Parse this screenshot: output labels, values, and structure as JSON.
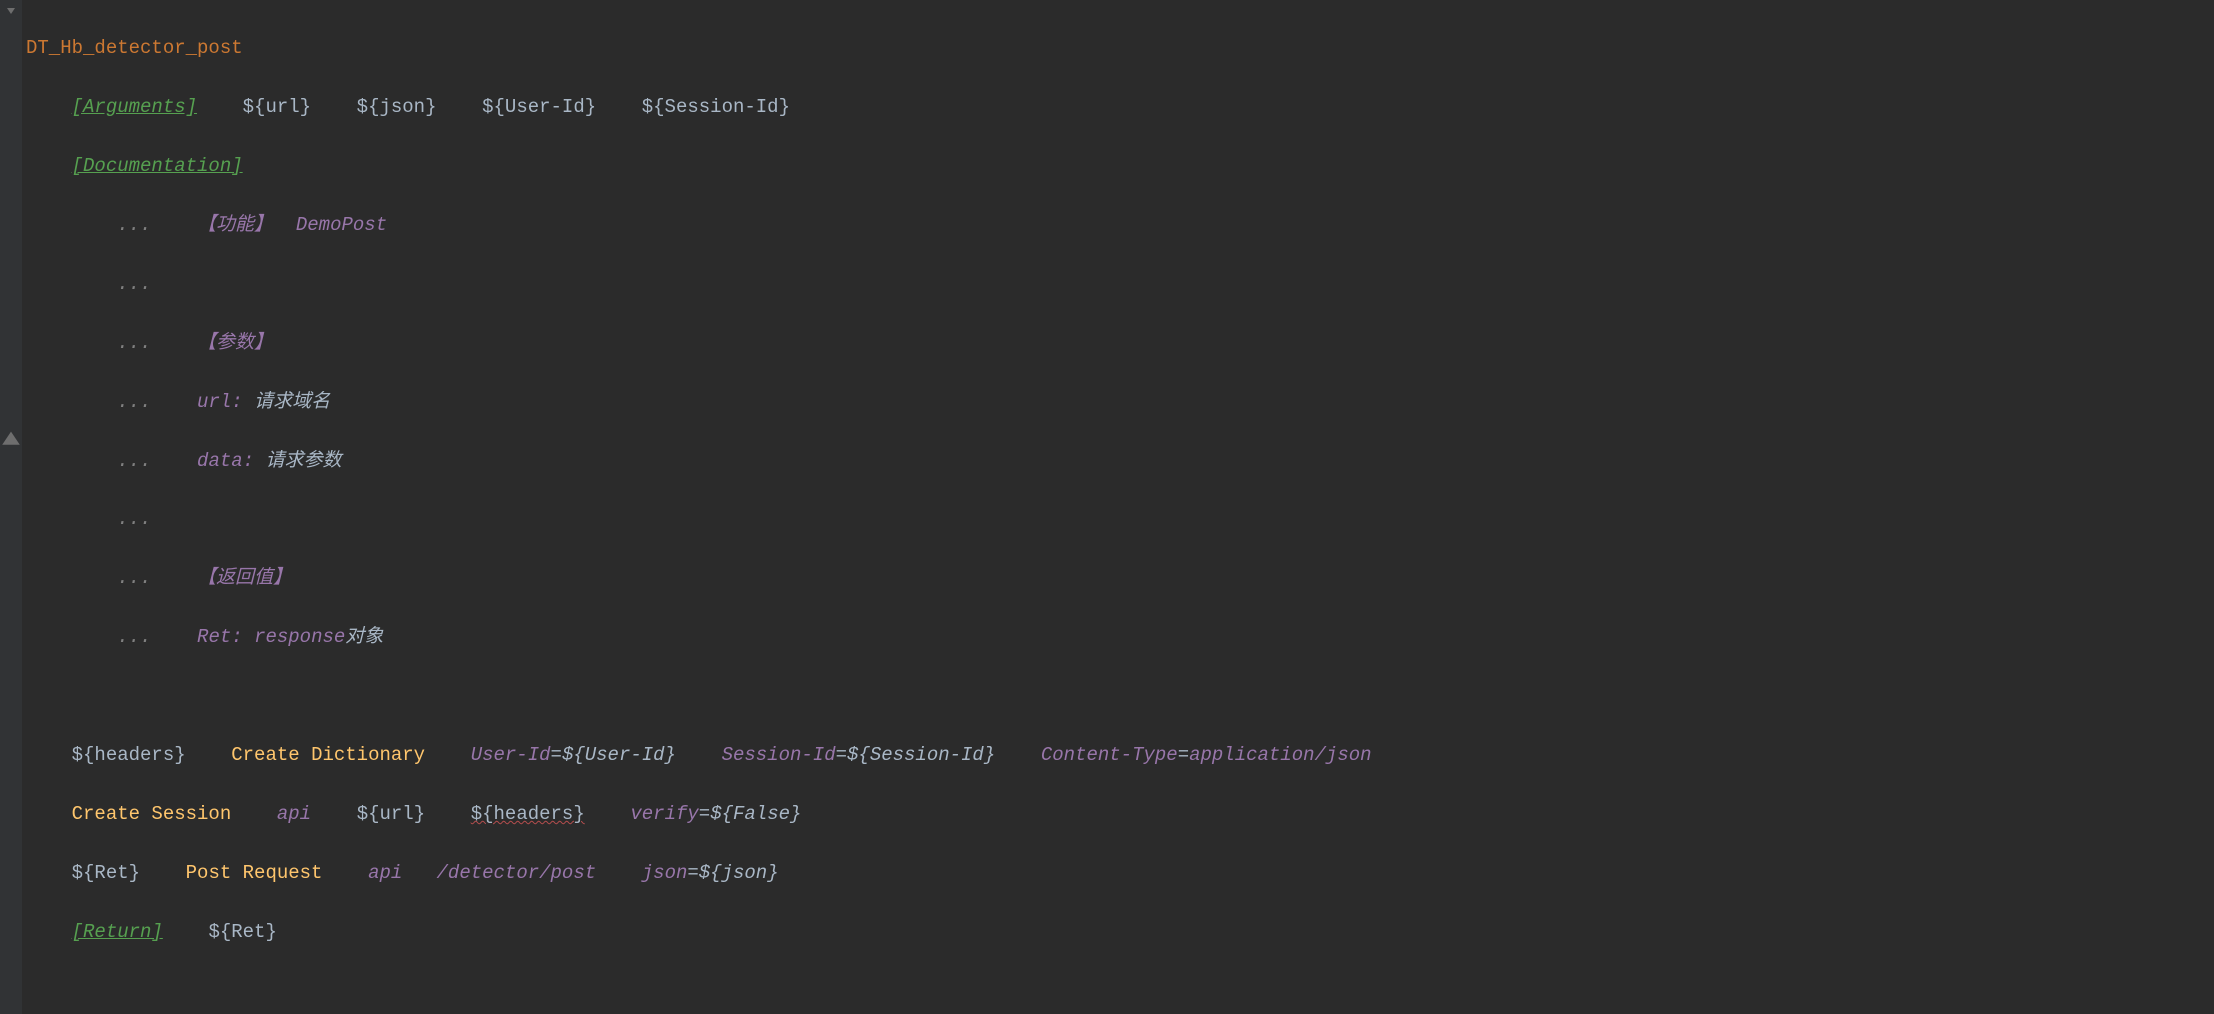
{
  "keyword_name": "DT_Hb_detector_post",
  "arguments_label": "[Arguments]",
  "arguments": {
    "url": "${url}",
    "json": "${json}",
    "user_id": "${User-Id}",
    "session_id": "${Session-Id}"
  },
  "documentation_label": "[Documentation]",
  "doc_lines": {
    "cont": "...",
    "func_tag": "【功能】",
    "func_val": "DemoPost",
    "param_tag": "【参数】",
    "url_label": "url:",
    "url_desc": "请求域名",
    "data_label": "data:",
    "data_desc": "请求参数",
    "ret_tag": "【返回值】",
    "ret_label": "Ret:",
    "ret_desc_en": "response",
    "ret_desc_cn": "对象"
  },
  "body": {
    "headers_var": "${headers}",
    "create_dict": "Create Dictionary",
    "user_id_key": "User-Id",
    "user_id_val": "${User-Id}",
    "session_id_key": "Session-Id",
    "session_id_val": "${Session-Id}",
    "content_type_key": "Content-Type",
    "content_type_val": "application/json",
    "create_session": "Create Session",
    "api": "api",
    "url_var": "${url}",
    "headers_arg": "${headers}",
    "verify_key": "verify",
    "verify_val": "${False}",
    "ret_var": "${Ret}",
    "post_request": "Post Request",
    "path": "/detector/post",
    "json_key": "json",
    "json_val": "${json}"
  },
  "return_label": "[Return]",
  "return_val": "${Ret}"
}
